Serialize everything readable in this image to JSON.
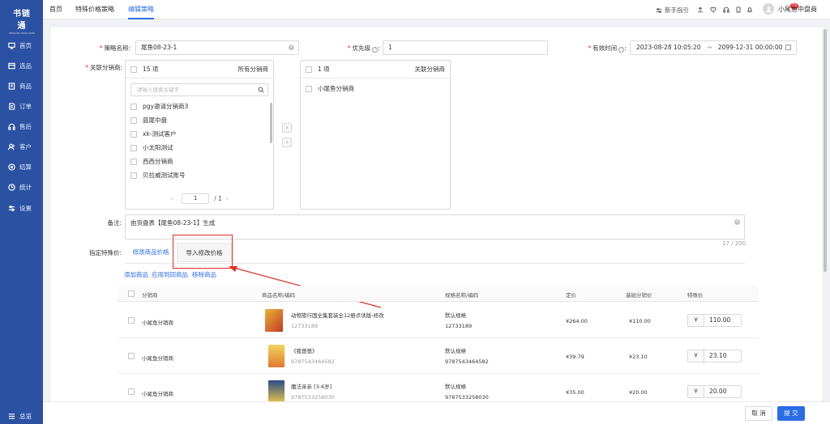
{
  "app": {
    "logo": "书链通",
    "logo_sub": "SHULIAN TONG SUPPLY CHAIN",
    "collapse_label": "总览"
  },
  "sidebar": {
    "items": [
      {
        "label": "首页",
        "icon": "monitor-icon"
      },
      {
        "label": "选品",
        "icon": "box-icon"
      },
      {
        "label": "商品",
        "icon": "book-icon"
      },
      {
        "label": "订单",
        "icon": "order-icon"
      },
      {
        "label": "售后",
        "icon": "headset-icon"
      },
      {
        "label": "客户",
        "icon": "users-icon"
      },
      {
        "label": "结算",
        "icon": "settle-icon"
      },
      {
        "label": "统计",
        "icon": "clock-icon"
      },
      {
        "label": "设置",
        "icon": "settings-icon"
      }
    ]
  },
  "header": {
    "tabs": [
      "首页",
      "特殊价格策略",
      "编辑策略"
    ],
    "guide": "新手指引",
    "badge": "10",
    "user": "小尾鱼中盘商"
  },
  "form": {
    "name_label": "策略名称:",
    "name_value": "尾鱼08-23-1",
    "priority_label": "优先级",
    "priority_value": "1",
    "valid_label": "有效时间",
    "valid_start": "2023-08-28 10:05:20",
    "valid_sep": "→",
    "valid_end": "2099-12-31 00:00:00",
    "distributor_label": "关联分销商:",
    "left_count": "15 项",
    "left_title": "所有分销商",
    "search_placeholder": "请输入搜索关键字",
    "left_items": [
      "pgy邀请分销商3",
      "庭尾中盘",
      "xk-测试客户",
      "小太阳测试",
      "西西分销商",
      "贝拉威测试账号"
    ],
    "page_current": "1",
    "page_total": "/ 1",
    "right_count": "1 项",
    "right_title": "关联分销商",
    "right_items": [
      "小尾鱼分销商"
    ],
    "note_label": "备注:",
    "note_value": "由货盘表【尾鱼08-23-1】生成",
    "note_counter": "17 / 200",
    "special_label": "指定特殊价:"
  },
  "tabs": {
    "modify": "修改商品价格",
    "import": "导入修改价格"
  },
  "actions": {
    "add": "添加商品",
    "apply_same": "应用到同商品",
    "remove": "移除商品"
  },
  "table": {
    "headers": [
      "分销商",
      "商品名称/编码",
      "规格名称/编码",
      "定价",
      "基础分销价",
      "特殊价"
    ],
    "rows": [
      {
        "distributor": "小尾鱼分销商",
        "name": "动物旅行国全集套装全12册点读版-修改",
        "code": "12733189",
        "spec": "默认规格",
        "spec_code": "12733189",
        "price": "¥264.00",
        "base": "¥110.00",
        "special": "110.00"
      },
      {
        "distributor": "小尾鱼分销商",
        "name": "《我爸爸》",
        "code": "9787543464582",
        "spec": "默认规格",
        "spec_code": "9787543464582",
        "price": "¥39.79",
        "base": "¥23.10",
        "special": "23.10"
      },
      {
        "distributor": "小尾鱼分销商",
        "name": "魔法亲亲 [3-6岁]",
        "code": "9787533258030",
        "spec": "默认规格",
        "spec_code": "9787533258030",
        "price": "¥35.00",
        "base": "¥20.00",
        "special": "20.00"
      }
    ],
    "currency": "¥"
  },
  "footer": {
    "cancel": "取 消",
    "submit": "提 交"
  },
  "colors": {
    "sidebar": "#2b51a3",
    "primary": "#2b6de5",
    "annotation": "#e0302a"
  }
}
